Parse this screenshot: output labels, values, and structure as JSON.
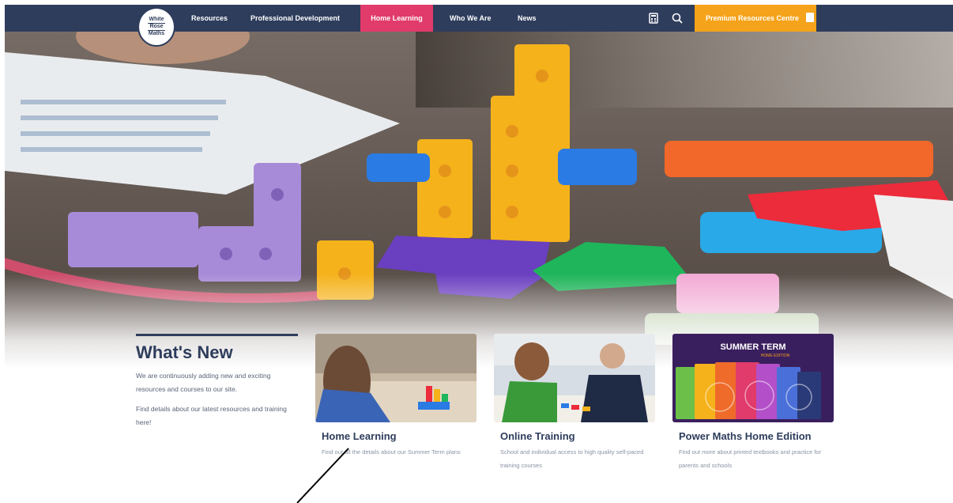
{
  "logo": {
    "line1": "White",
    "line2": "Rose",
    "line3": "Maths"
  },
  "nav": {
    "links": [
      "Resources",
      "Professional Development",
      "Home Learning",
      "Who We Are",
      "News"
    ],
    "active_index": 2,
    "cta_label": "Premium Resources Centre",
    "icons": [
      "calculator-icon",
      "search-icon"
    ]
  },
  "whats_new": {
    "title": "What's New",
    "para1": "We are continuously adding new and exciting resources and courses to our site.",
    "para2": "Find details about our latest resources and training here!"
  },
  "cards": [
    {
      "title": "Home Learning",
      "desc": "Find out all the details about our Summer Term plans"
    },
    {
      "title": "Online Training",
      "desc": "School and individual access to high quality self-paced training courses"
    },
    {
      "title": "Power Maths Home Edition",
      "desc": "Find out more about printed textbooks and practice for parents and schools",
      "banner": "SUMMER TERM",
      "banner_sub": "HOME EDITION"
    }
  ],
  "colors": {
    "nav_bg": "#2e3d5c",
    "active": "#e03b6a",
    "cta": "#f5a31a",
    "heading": "#2e3d5c"
  }
}
